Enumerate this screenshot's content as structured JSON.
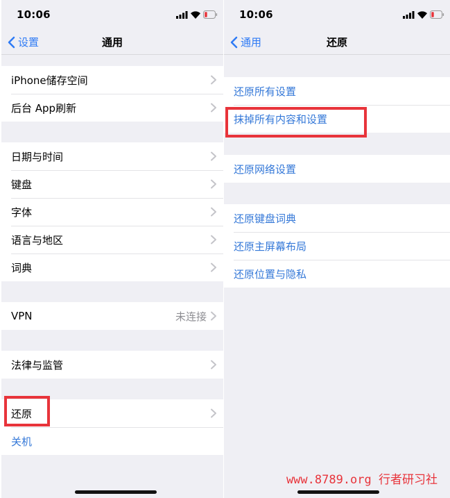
{
  "left": {
    "time": "10:06",
    "nav": {
      "back_label": "设置",
      "title": "通用"
    },
    "groups": [
      {
        "items": [
          {
            "label": "iPhone储存空间"
          },
          {
            "label": "后台 App刷新"
          }
        ]
      },
      {
        "items": [
          {
            "label": "日期与时间"
          },
          {
            "label": "键盘"
          },
          {
            "label": "字体"
          },
          {
            "label": "语言与地区"
          },
          {
            "label": "词典"
          }
        ]
      },
      {
        "items": [
          {
            "label": "VPN",
            "value": "未连接"
          }
        ]
      },
      {
        "items": [
          {
            "label": "法律与监管"
          }
        ]
      },
      {
        "items": [
          {
            "label": "还原"
          },
          {
            "label": "关机"
          }
        ]
      }
    ]
  },
  "right": {
    "time": "10:06",
    "nav": {
      "back_label": "通用",
      "title": "还原"
    },
    "groups": [
      {
        "items": [
          {
            "label": "还原所有设置"
          },
          {
            "label": "抹掉所有内容和设置"
          }
        ]
      },
      {
        "items": [
          {
            "label": "还原网络设置"
          }
        ]
      },
      {
        "items": [
          {
            "label": "还原键盘词典"
          },
          {
            "label": "还原主屏幕布局"
          },
          {
            "label": "还原位置与隐私"
          }
        ]
      }
    ]
  },
  "watermark": "www.8789.org 行者研习社",
  "colors": {
    "accent": "#3478d8",
    "highlight": "#e8343b",
    "background": "#efeff4"
  },
  "icons": [
    "signal-icon",
    "wifi-icon",
    "battery-low-icon",
    "chevron-left-icon",
    "chevron-right-icon"
  ]
}
